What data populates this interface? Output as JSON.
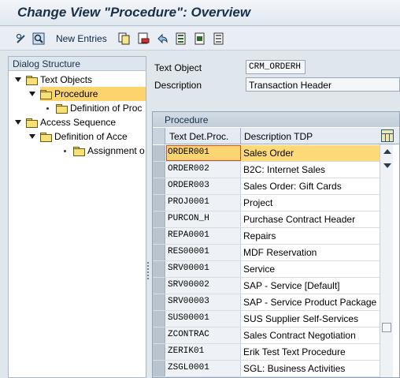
{
  "window": {
    "title": "Change View \"Procedure\": Overview"
  },
  "toolbar": {
    "new_entries_label": "New Entries",
    "icons": [
      "glasses-pencil-icon",
      "find-icon",
      "copy-icon",
      "delete-icon",
      "undo-icon",
      "select-all-icon",
      "select-block-icon",
      "deselect-all-icon"
    ]
  },
  "dialog_structure": {
    "header": "Dialog Structure",
    "items": [
      {
        "label": "Text Objects",
        "level": 0,
        "expanded": true,
        "selected": false
      },
      {
        "label": "Procedure",
        "level": 1,
        "expanded": true,
        "selected": true
      },
      {
        "label": "Definition of Proc",
        "level": 2,
        "expanded": false,
        "selected": false
      },
      {
        "label": "Access Sequence",
        "level": 0,
        "expanded": true,
        "selected": false
      },
      {
        "label": "Definition of Acce",
        "level": 1,
        "expanded": true,
        "selected": false
      },
      {
        "label": "Assignment o",
        "level": 2,
        "expanded": false,
        "selected": false
      }
    ]
  },
  "fields": {
    "text_object": {
      "label": "Text Object",
      "value": "CRM_ORDERH"
    },
    "description": {
      "label": "Description",
      "value": "Transaction Header"
    }
  },
  "table": {
    "title": "Procedure",
    "columns": [
      "Text Det.Proc.",
      "Description TDP"
    ],
    "rows": [
      {
        "code": "ORDER001",
        "desc": "Sales Order"
      },
      {
        "code": "ORDER002",
        "desc": "B2C: Internet Sales"
      },
      {
        "code": "ORDER003",
        "desc": "Sales Order: Gift Cards"
      },
      {
        "code": "PROJ0001",
        "desc": "Project"
      },
      {
        "code": "PURCON_H",
        "desc": "Purchase Contract Header"
      },
      {
        "code": "REPA0001",
        "desc": "Repairs"
      },
      {
        "code": "RES00001",
        "desc": "MDF Reservation"
      },
      {
        "code": "SRV00001",
        "desc": "Service"
      },
      {
        "code": "SRV00002",
        "desc": "SAP - Service [Default]"
      },
      {
        "code": "SRV00003",
        "desc": "SAP - Service Product Package"
      },
      {
        "code": "SUS00001",
        "desc": "SUS Supplier Self-Services"
      },
      {
        "code": "ZCONTRAC",
        "desc": "Sales Contract Negotiation"
      },
      {
        "code": "ZERIK01",
        "desc": "Erik Test Text Procedure"
      },
      {
        "code": "ZSGL0001",
        "desc": "SGL: Business Activities"
      }
    ],
    "active_row": 0
  },
  "colors": {
    "selection": "#fdd36b",
    "title_text": "#1a2f4a"
  }
}
